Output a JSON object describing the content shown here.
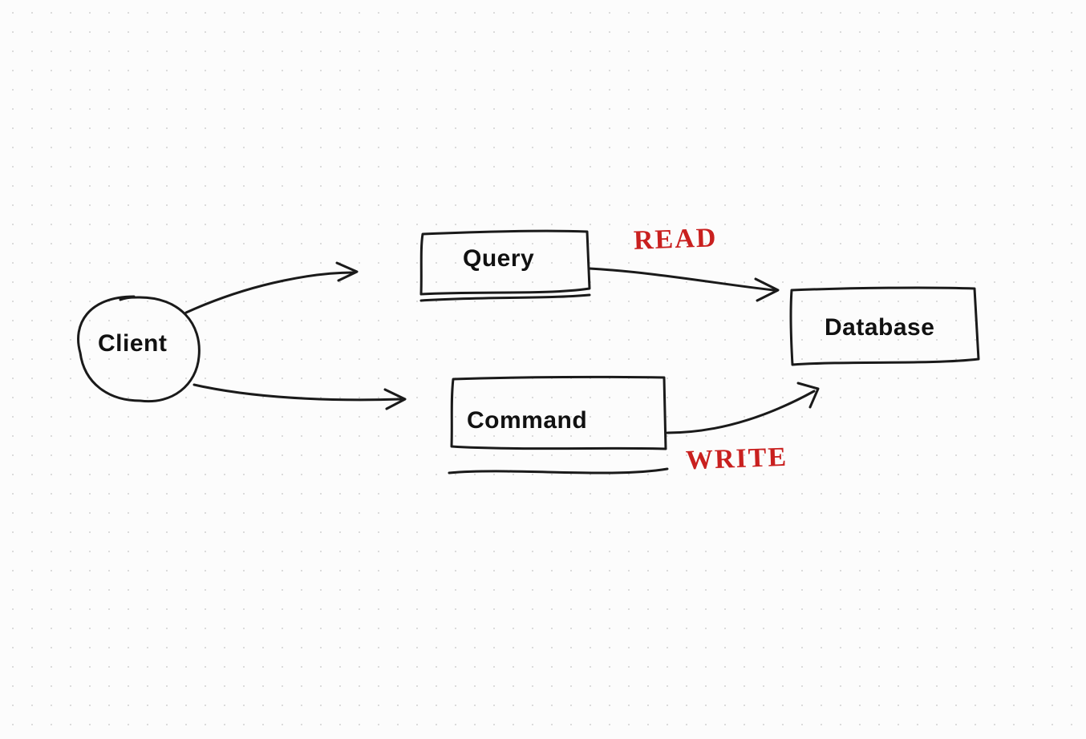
{
  "nodes": {
    "client": {
      "label": "Client"
    },
    "query": {
      "label": "Query"
    },
    "command": {
      "label": "Command"
    },
    "database": {
      "label": "Database"
    }
  },
  "edges": {
    "client_to_query": {
      "from": "client",
      "to": "query"
    },
    "client_to_command": {
      "from": "client",
      "to": "command"
    },
    "query_to_database": {
      "from": "query",
      "to": "database",
      "annotation": "READ"
    },
    "command_to_database": {
      "from": "command",
      "to": "database",
      "annotation": "WRITE"
    }
  },
  "colors": {
    "stroke": "#1a1a1a",
    "annotation": "#c9201f"
  }
}
